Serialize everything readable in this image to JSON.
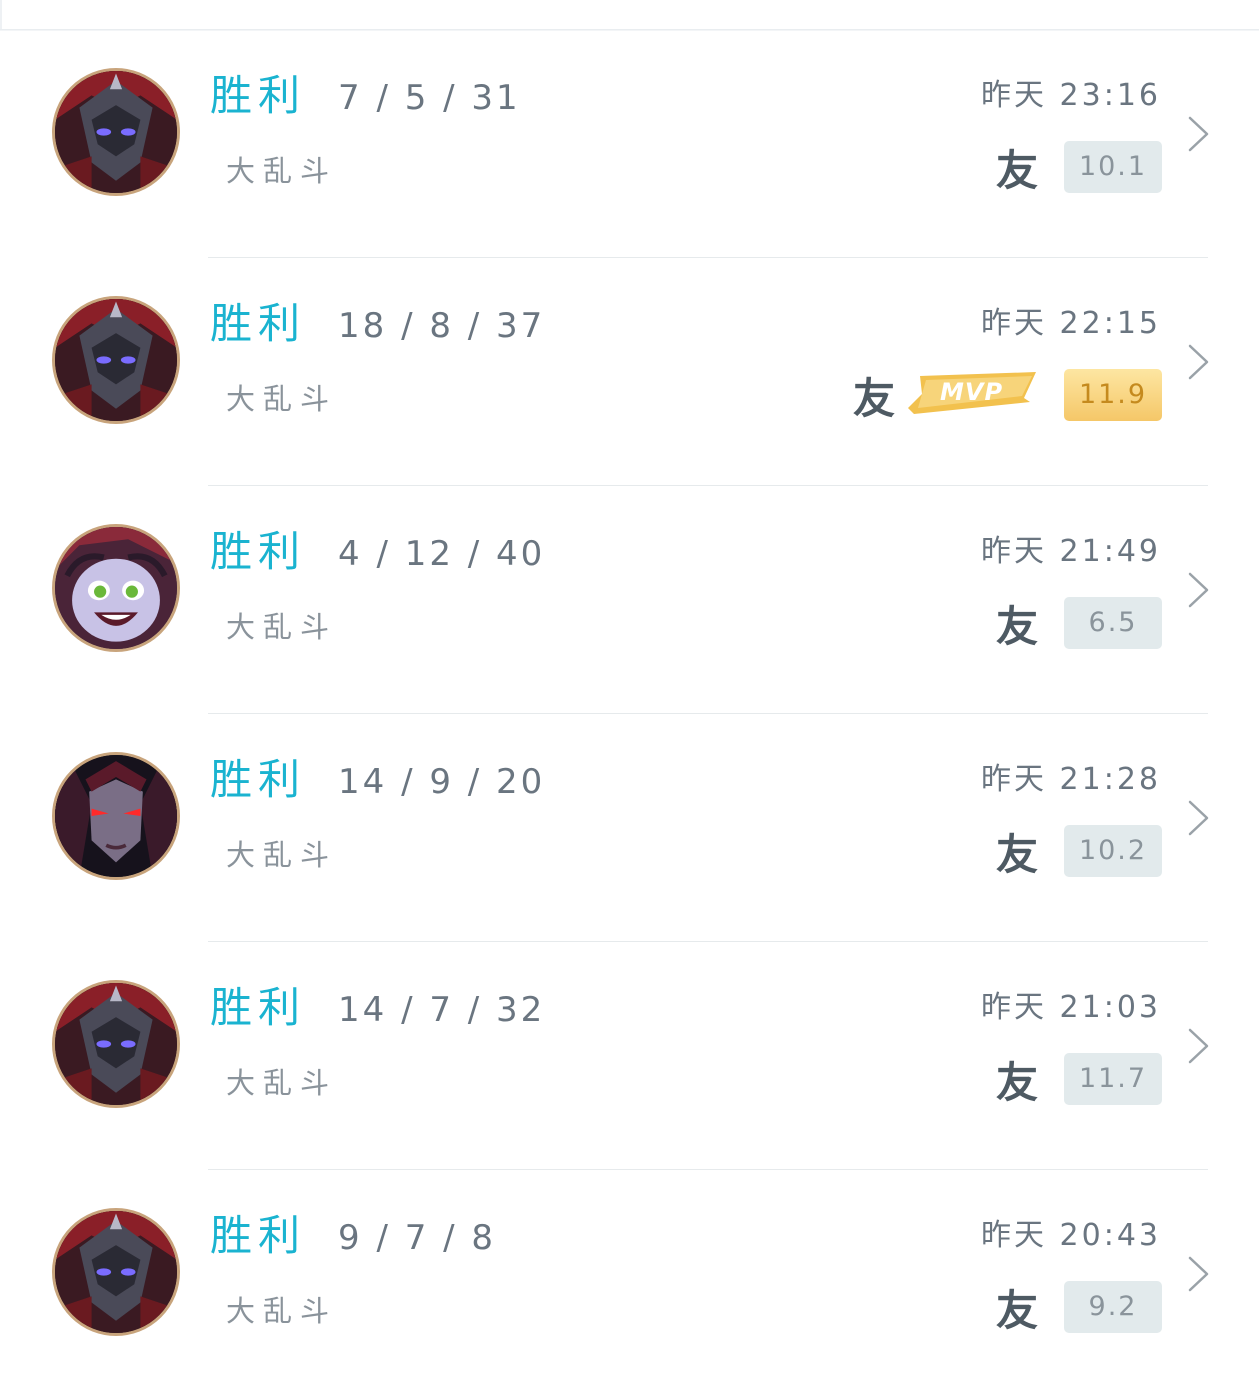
{
  "matches": [
    {
      "result": "胜利",
      "kda": "7 / 5 / 31",
      "mode": "大乱斗",
      "day": "昨天",
      "time": "23:16",
      "friend_tag": "友",
      "mvp": false,
      "score": "10.1",
      "champion_icon": "dark-knight-champion-icon"
    },
    {
      "result": "胜利",
      "kda": "18 / 8 / 37",
      "mode": "大乱斗",
      "day": "昨天",
      "time": "22:15",
      "friend_tag": "友",
      "mvp": true,
      "mvp_label": "MVP",
      "score": "11.9",
      "champion_icon": "dark-knight-champion-icon"
    },
    {
      "result": "胜利",
      "kda": "4 / 12 / 40",
      "mode": "大乱斗",
      "day": "昨天",
      "time": "21:49",
      "friend_tag": "友",
      "mvp": false,
      "score": "6.5",
      "champion_icon": "witch-girl-champion-icon"
    },
    {
      "result": "胜利",
      "kda": "14 / 9 / 20",
      "mode": "大乱斗",
      "day": "昨天",
      "time": "21:28",
      "friend_tag": "友",
      "mvp": false,
      "score": "10.2",
      "champion_icon": "dark-sorceress-champion-icon"
    },
    {
      "result": "胜利",
      "kda": "14 / 7 / 32",
      "mode": "大乱斗",
      "day": "昨天",
      "time": "21:03",
      "friend_tag": "友",
      "mvp": false,
      "score": "11.7",
      "champion_icon": "dark-knight-champion-icon"
    },
    {
      "result": "胜利",
      "kda": "9 / 7 / 8",
      "mode": "大乱斗",
      "day": "昨天",
      "time": "20:43",
      "friend_tag": "友",
      "mvp": false,
      "score": "9.2",
      "champion_icon": "dark-knight-champion-icon"
    }
  ],
  "colors": {
    "result_win": "#1ab3d0",
    "score_bg": "#e2eaec",
    "score_mvp_bg": "#f5c768",
    "avatar_border": "#c8a47c"
  }
}
